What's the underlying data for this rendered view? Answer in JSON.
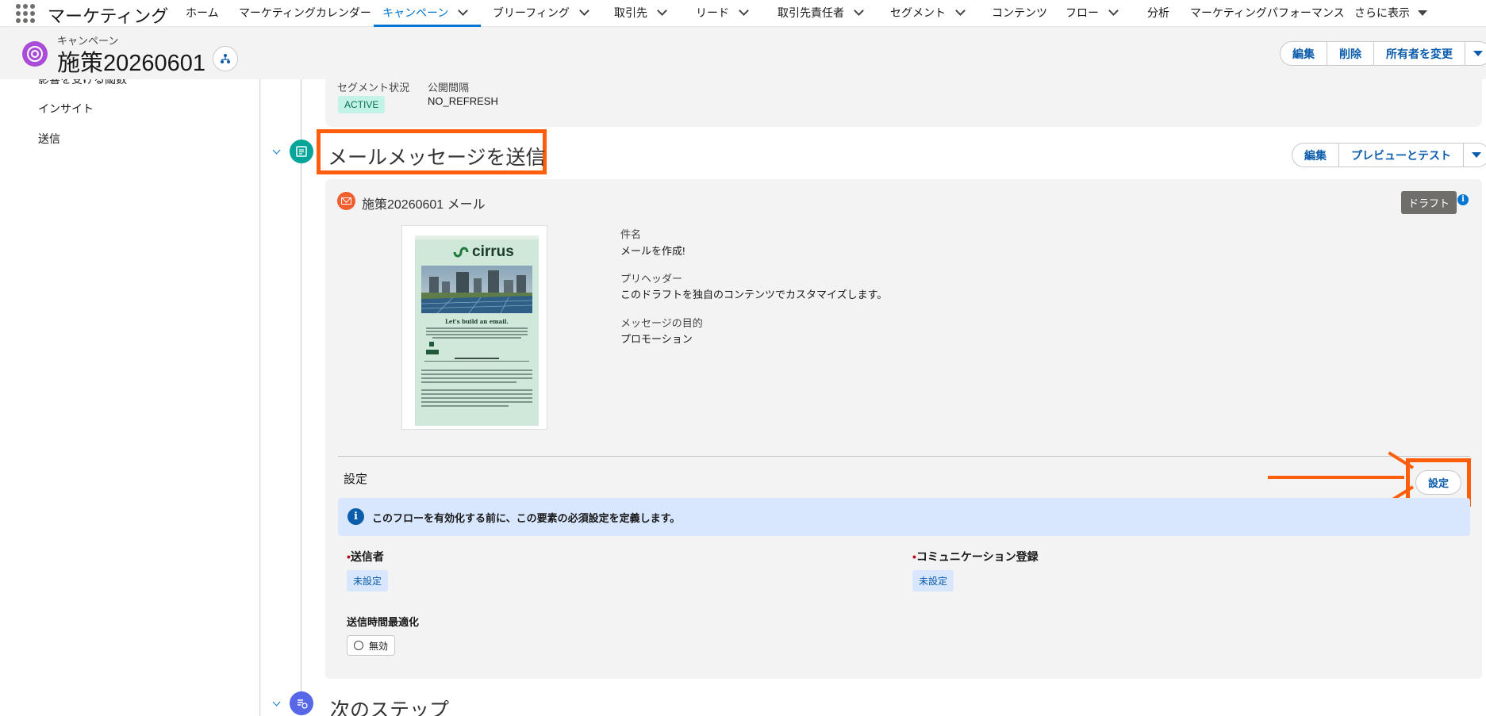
{
  "app": {
    "name": "マーケティング"
  },
  "nav": {
    "items": [
      {
        "label": "ホーム"
      },
      {
        "label": "マーケティングカレンダー"
      },
      {
        "label": "キャンペーン"
      },
      {
        "label": "ブリーフィング"
      },
      {
        "label": "取引先"
      },
      {
        "label": "リード"
      },
      {
        "label": "取引先責任者"
      },
      {
        "label": "セグメント"
      },
      {
        "label": "コンテンツ"
      },
      {
        "label": "フロー"
      },
      {
        "label": "分析"
      },
      {
        "label": "マーケティングパフォーマンス"
      },
      {
        "label": "さらに表示"
      }
    ],
    "active": "キャンペーン"
  },
  "header": {
    "record_type": "キャンペーン",
    "title": "施策20260601",
    "actions": {
      "edit": "編集",
      "delete": "削除",
      "change_owner": "所有者を変更"
    }
  },
  "leftpanel": {
    "items": [
      {
        "label": "影響を受ける閾数"
      },
      {
        "label": "インサイト"
      },
      {
        "label": "送信"
      }
    ]
  },
  "segment": {
    "status_label": "セグメント状況",
    "status_value": "ACTIVE",
    "interval_label": "公開間隔",
    "interval_value": "NO_REFRESH"
  },
  "send_email": {
    "title": "メールメッセージを送信",
    "actions": {
      "edit": "編集",
      "preview": "プレビューとテスト"
    },
    "email_name": "施策20260601 メール",
    "draft": "ドラフト",
    "fields": {
      "subject_label": "件名",
      "subject_value": "メールを作成!",
      "preheader_label": "プリヘッダー",
      "preheader_value": "このドラフトを独自のコンテンツでカスタマイズします。",
      "purpose_label": "メッセージの目的",
      "purpose_value": "プロモーション"
    },
    "thumbnail": {
      "logo": "cirrus",
      "heading": "Let's build an email."
    },
    "settings": {
      "title": "設定",
      "button": "設定",
      "banner": "このフローを有効化する前に、この要素の必須設定を定義します。",
      "sender_label": "送信者",
      "sender_value": "未設定",
      "comm_label": "コミュニケーション登録",
      "comm_value": "未設定",
      "sendtime_label": "送信時間最適化",
      "sendtime_value": "無効"
    }
  },
  "next_step": {
    "title": "次のステップ"
  },
  "colors": {
    "accent": "#0176d3",
    "highlight": "#fe5e0b",
    "brand": "#a94cd8"
  }
}
